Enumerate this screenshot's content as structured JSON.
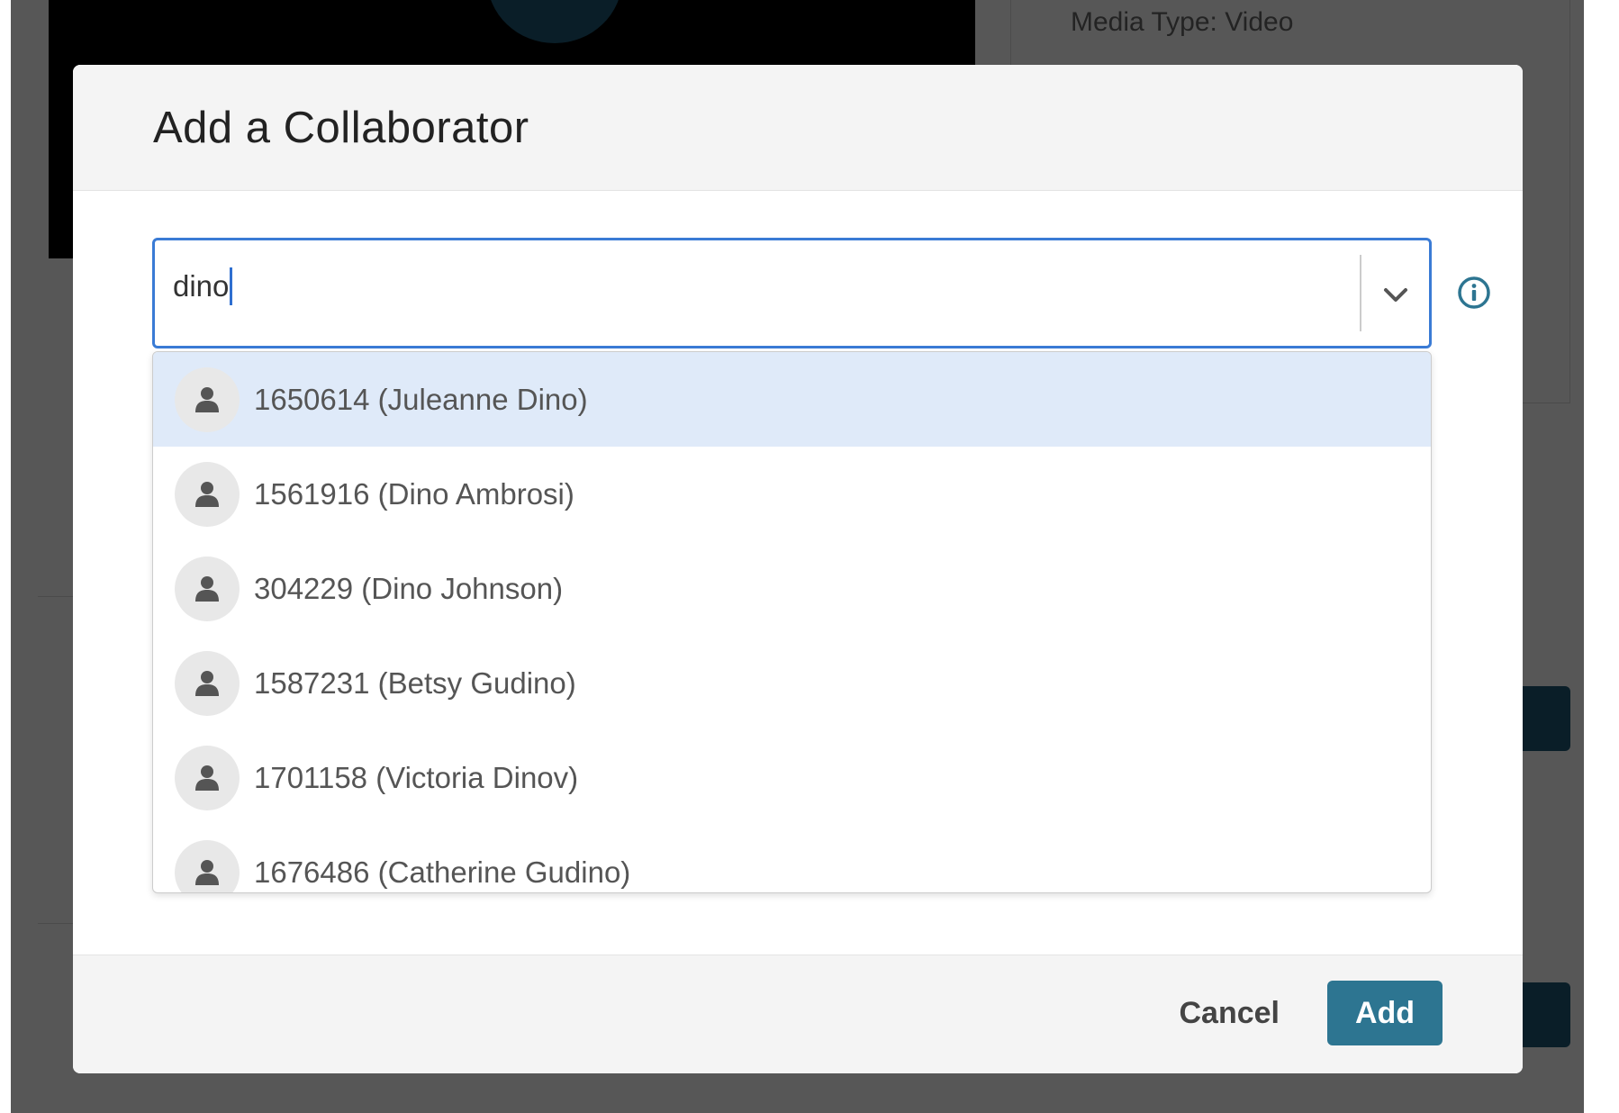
{
  "background": {
    "media_type": "Media Type: Video"
  },
  "modal": {
    "title": "Add a Collaborator",
    "search": {
      "value": "dino"
    },
    "options": [
      {
        "label": "1650614 (Juleanne Dino)",
        "highlighted": true
      },
      {
        "label": "1561916 (Dino Ambrosi)",
        "highlighted": false
      },
      {
        "label": "304229 (Dino Johnson)",
        "highlighted": false
      },
      {
        "label": "1587231 (Betsy Gudino)",
        "highlighted": false
      },
      {
        "label": "1701158 (Victoria Dinov)",
        "highlighted": false
      },
      {
        "label": "1676486 (Catherine Gudino)",
        "highlighted": false
      }
    ],
    "footer": {
      "cancel_label": "Cancel",
      "add_label": "Add"
    }
  },
  "icons": {
    "user": "user-icon",
    "info": "info-icon",
    "chevron": "chevron-down-icon"
  },
  "colors": {
    "accent": "#2d7591",
    "focus_border": "#3a7bd5",
    "highlight": "#dfeaf9"
  }
}
